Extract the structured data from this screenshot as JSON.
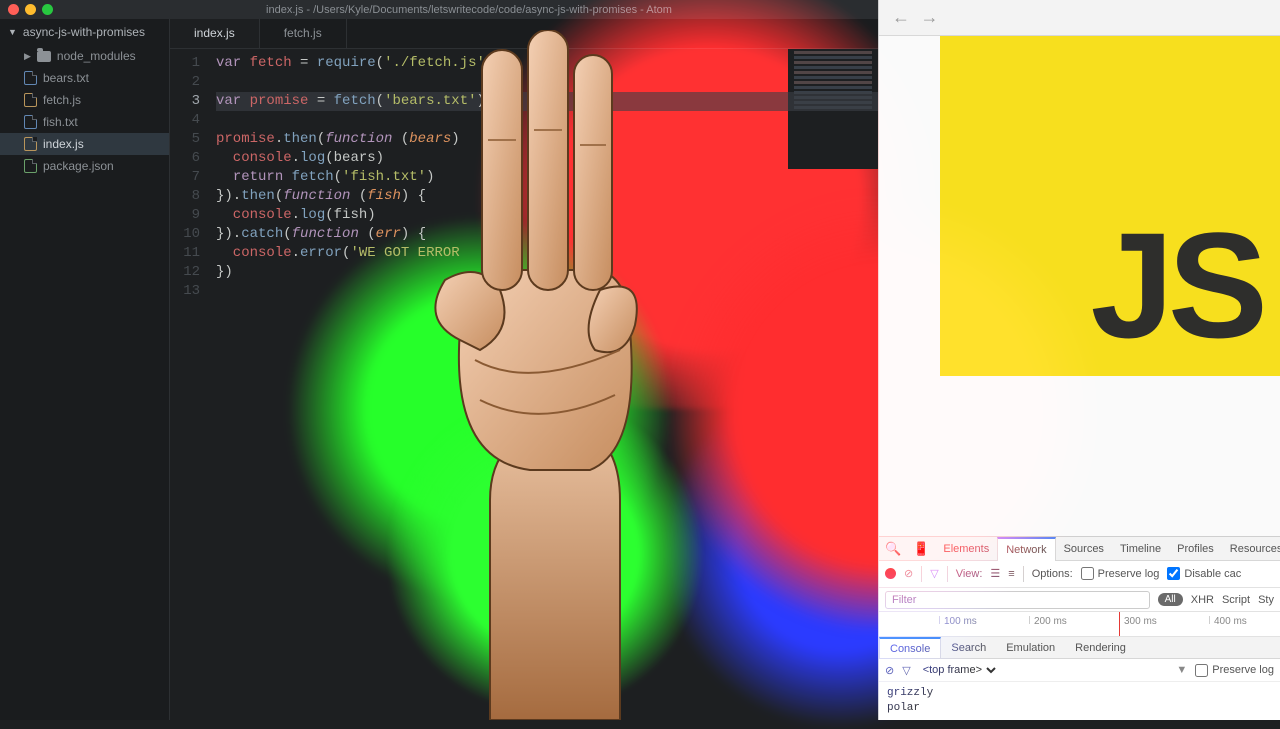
{
  "atom": {
    "window_title": "index.js - /Users/Kyle/Documents/letswritecode/code/async-js-with-promises - Atom",
    "project_name": "async-js-with-promises",
    "tree": [
      {
        "name": "node_modules",
        "type": "folder"
      },
      {
        "name": "bears.txt",
        "type": "txt"
      },
      {
        "name": "fetch.js",
        "type": "js"
      },
      {
        "name": "fish.txt",
        "type": "txt"
      },
      {
        "name": "index.js",
        "type": "js",
        "selected": true
      },
      {
        "name": "package.json",
        "type": "json"
      }
    ],
    "tabs": [
      {
        "label": "index.js",
        "active": true
      },
      {
        "label": "fetch.js",
        "active": false
      }
    ],
    "line_numbers": [
      "1",
      "2",
      "3",
      "4",
      "5",
      "6",
      "7",
      "8",
      "9",
      "10",
      "11",
      "12",
      "13"
    ],
    "current_line": 3
  },
  "code": {
    "l1": {
      "a": "var ",
      "b": "fetch",
      "c": " = ",
      "d": "require",
      "e": "(",
      "f": "'./fetch.js'",
      "g": ")"
    },
    "l3": {
      "a": "var ",
      "b": "promise",
      "c": " = ",
      "d": "fetch",
      "e": "(",
      "f": "'bears",
      "g": ".txt'",
      "h": ")"
    },
    "l5": {
      "a": "promise",
      "b": ".",
      "c": "then",
      "d": "(",
      "e": "function ",
      "f": "(",
      "g": "bears",
      "h": ")"
    },
    "l6": {
      "a": "  console",
      "b": ".",
      "c": "log",
      "d": "(bears)"
    },
    "l7": {
      "a": "  ",
      "b": "return ",
      "c": "fetch",
      "d": "(",
      "e": "'fish.txt'",
      "f": ")"
    },
    "l8": {
      "a": "}).",
      "b": "then",
      "c": "(",
      "d": "function ",
      "e": "(",
      "f": "fish",
      "g": ") {"
    },
    "l9": {
      "a": "  console",
      "b": ".",
      "c": "log",
      "d": "(fish)"
    },
    "l10": {
      "a": "}).",
      "b": "catch",
      "c": "(",
      "d": "function ",
      "e": "(",
      "f": "err",
      "g": ") {"
    },
    "l11": {
      "a": "  console",
      "b": ".",
      "c": "error",
      "d": "(",
      "e": "'WE GOT ERROR",
      "f": ""
    },
    "l12": {
      "a": "})"
    }
  },
  "js_logo": "JS",
  "devtools": {
    "tabs": [
      "Elements",
      "Network",
      "Sources",
      "Timeline",
      "Profiles",
      "Resources"
    ],
    "active_tab": "Network",
    "view_label": "View:",
    "options_label": "Options:",
    "preserve_log": "Preserve log",
    "disable_cache": "Disable cac",
    "filter_placeholder": "Filter",
    "all_pill": "All",
    "filter_segments": [
      "XHR",
      "Script",
      "Sty"
    ],
    "ticks": [
      "100 ms",
      "200 ms",
      "300 ms",
      "400 ms"
    ],
    "drawer_tabs": [
      "Console",
      "Search",
      "Emulation",
      "Rendering"
    ],
    "active_drawer": "Console",
    "frame_select": "<top frame>",
    "preserve_log2": "Preserve log",
    "console_output": [
      "grizzly",
      "polar"
    ]
  }
}
